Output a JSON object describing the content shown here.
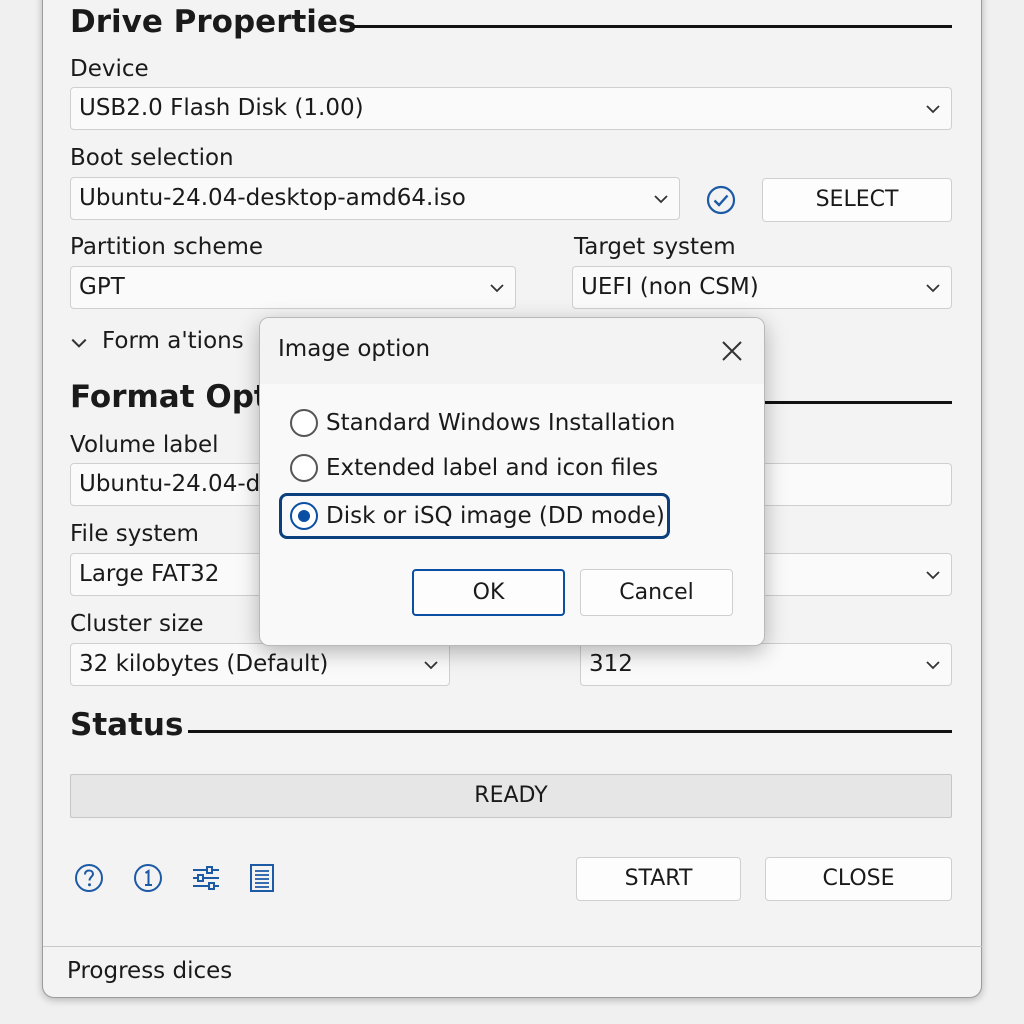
{
  "drive_properties": {
    "title": "Drive Properties",
    "device_label": "Device",
    "device_value": "USB2.0 Flash Disk (1.00)",
    "boot_label": "Boot selection",
    "boot_value": "Ubuntu-24.04-desktop-amd64.iso",
    "select_button": "SELECT",
    "partition_label": "Partition scheme",
    "partition_value": "GPT",
    "target_label": "Target system",
    "target_value": "UEFI (non CSM)",
    "advanced_toggle": "Form a'tions"
  },
  "format_options": {
    "title": "Format Opti",
    "volume_label": "Volume label",
    "volume_value": "Ubuntu-24.04-de",
    "filesystem_label": "File system",
    "filesystem_value": "Large FAT32",
    "cluster_label": "Cluster size",
    "cluster_value": "32 kilobytes (Default)",
    "right_value": "312"
  },
  "status": {
    "title": "Status",
    "value": "READY",
    "start_button": "START",
    "close_button": "CLOSE"
  },
  "footer": {
    "text": "Progress dices"
  },
  "dialog": {
    "title": "Image option",
    "options": [
      {
        "label": "Standard Windows Installation",
        "selected": false
      },
      {
        "label": "Extended label and icon files",
        "selected": false
      },
      {
        "label": "Disk or iSQ image (DD mode)",
        "selected": true
      }
    ],
    "ok_button": "OK",
    "cancel_button": "Cancel"
  },
  "icons": {
    "help": "help-icon",
    "info": "info-icon",
    "settings": "sliders-icon",
    "log": "log-icon",
    "verify": "check-circle-icon"
  },
  "colors": {
    "accent": "#0a4fa3",
    "icon_blue": "#1d5aa6"
  }
}
